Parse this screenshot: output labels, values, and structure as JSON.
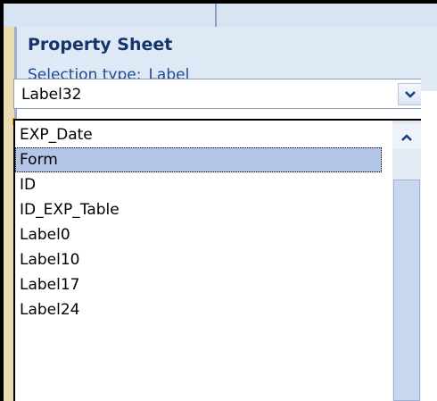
{
  "property_sheet": {
    "title": "Property Sheet",
    "selection_type_label": "Selection type:",
    "selection_type_value": "Label",
    "object_combo": {
      "value": "Label32",
      "dropdown_icon": "chevron-down-icon"
    },
    "object_list": {
      "items": [
        "EXP_Date",
        "Form",
        "ID",
        "ID_EXP_Table",
        "Label0",
        "Label10",
        "Label17",
        "Label24"
      ],
      "selected_item": "Form",
      "scroll_up_icon": "chevron-up-icon"
    }
  },
  "colors": {
    "title": "#14356b",
    "selection_type": "#1e4b91",
    "header_background": "#dfe9f5",
    "selected_row": "#b4c6e7",
    "scrollbar_track": "#e4ebf5"
  }
}
